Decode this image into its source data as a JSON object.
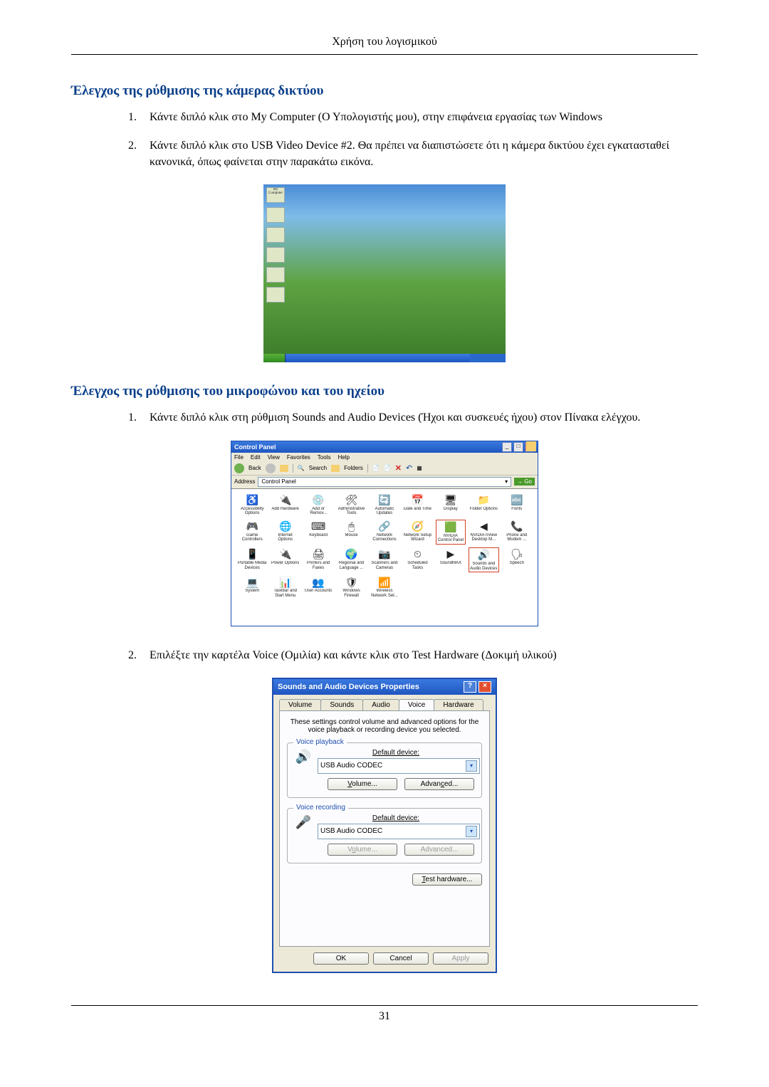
{
  "header": "Χρήση του λογισμικού",
  "page_number": "31",
  "section1": {
    "title": "Έλεγχος της ρύθμισης της κάμερας δικτύου",
    "items": [
      {
        "num": "1.",
        "text": "Κάντε διπλό κλικ στο My Computer (Ο Υπολογιστής μου), στην επιφάνεια εργασίας των Windows"
      },
      {
        "num": "2.",
        "text": "Κάντε διπλό κλικ στο USB Video Device #2. Θα πρέπει να διαπιστώσετε ότι η κάμερα δικτύου έχει εγκατασταθεί κανονικά, όπως φαίνεται στην παρακάτω εικόνα."
      }
    ]
  },
  "xp": {
    "icons": [
      "My Computer",
      "",
      "",
      "",
      "",
      ""
    ]
  },
  "section2": {
    "title": "Έλεγχος της ρύθμισης του μικροφώνου και του ηχείου",
    "items": [
      {
        "num": "1.",
        "text": "Κάντε διπλό κλικ στη ρύθμιση Sounds and Audio Devices (Ήχοι και συσκευές ήχου) στον Πίνακα ελέγχου."
      },
      {
        "num": "2.",
        "text": "Επιλέξτε την καρτέλα Voice (Ομιλία) και κάντε κλικ στο Test Hardware (Δοκιμή υλικού)"
      }
    ]
  },
  "controlpanel": {
    "title": "Control Panel",
    "menubar": [
      "File",
      "Edit",
      "View",
      "Favorites",
      "Tools",
      "Help"
    ],
    "toolbar": {
      "back": "Back",
      "search": "Search",
      "folders": "Folders"
    },
    "addr_label": "Address",
    "addr_value": "Control Panel",
    "go": "Go",
    "items": [
      {
        "i": "♿",
        "l": "Accessibility Options"
      },
      {
        "i": "🔌",
        "l": "Add Hardware"
      },
      {
        "i": "💿",
        "l": "Add or Remov..."
      },
      {
        "i": "🛠",
        "l": "Administrative Tools"
      },
      {
        "i": "🔄",
        "l": "Automatic Updates"
      },
      {
        "i": "📅",
        "l": "Date and Time"
      },
      {
        "i": "🖥",
        "l": "Display"
      },
      {
        "i": "📁",
        "l": "Folder Options"
      },
      {
        "i": "🔤",
        "l": "Fonts"
      },
      {
        "i": "🎮",
        "l": "Game Controllers"
      },
      {
        "i": "🌐",
        "l": "Internet Options"
      },
      {
        "i": "⌨",
        "l": "Keyboard"
      },
      {
        "i": "🖱",
        "l": "Mouse"
      },
      {
        "i": "🔗",
        "l": "Network Connections"
      },
      {
        "i": "🧭",
        "l": "Network Setup Wizard"
      },
      {
        "i": "🟩",
        "l": "NVIDIA Control Panel",
        "hl": true
      },
      {
        "i": "◀",
        "l": "NVIDIA nView Desktop M..."
      },
      {
        "i": "📞",
        "l": "Phone and Modem ..."
      },
      {
        "i": "📱",
        "l": "Portable Media Devices"
      },
      {
        "i": "🔌",
        "l": "Power Options"
      },
      {
        "i": "🖨",
        "l": "Printers and Faxes"
      },
      {
        "i": "🌍",
        "l": "Regional and Language ..."
      },
      {
        "i": "📷",
        "l": "Scanners and Cameras"
      },
      {
        "i": "⏲",
        "l": "Scheduled Tasks"
      },
      {
        "i": "▶",
        "l": "SoundMAX"
      },
      {
        "i": "🔊",
        "l": "Sounds and Audio Devices",
        "hl": true
      },
      {
        "i": "🗣",
        "l": "Speech"
      },
      {
        "i": "💻",
        "l": "System"
      },
      {
        "i": "📊",
        "l": "Taskbar and Start Menu"
      },
      {
        "i": "👥",
        "l": "User Accounts"
      },
      {
        "i": "🛡",
        "l": "Windows Firewall"
      },
      {
        "i": "📶",
        "l": "Wireless Network Set..."
      }
    ]
  },
  "sad": {
    "title": "Sounds and Audio Devices Properties",
    "tabs": [
      "Volume",
      "Sounds",
      "Audio",
      "Voice",
      "Hardware"
    ],
    "active_tab": "Voice",
    "desc": "These settings control volume and advanced options for the voice playback or recording device you selected.",
    "playback_legend": "Voice playback",
    "recording_legend": "Voice recording",
    "default_device": "Default device:",
    "playback_device": "USB Audio CODEC",
    "recording_device": "USB Audio CODEC",
    "btn_volume": "Volume...",
    "btn_advanced": "Advanced...",
    "btn_volume_u": "V",
    "btn_advanced_u": "c",
    "btn_volume2_u": "o",
    "btn_testhw": "Test hardware...",
    "btn_testhw_u": "T",
    "ok": "OK",
    "cancel": "Cancel",
    "apply": "Apply"
  }
}
